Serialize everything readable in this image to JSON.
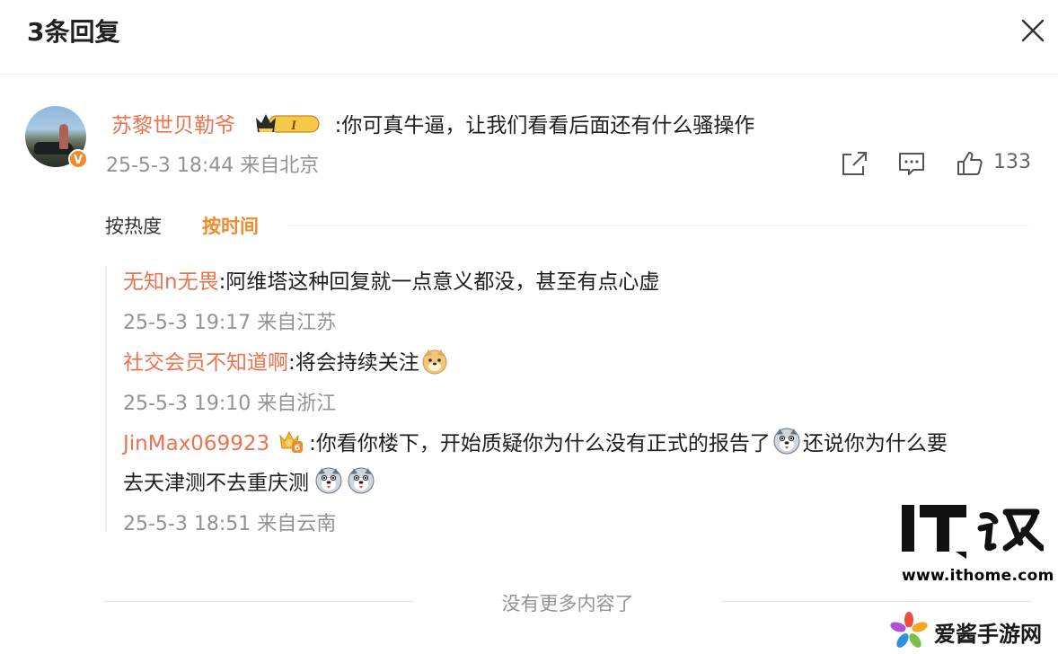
{
  "header": {
    "title": "3条回复",
    "close_icon": "close-icon"
  },
  "main_comment": {
    "username": "苏黎世贝勒爷",
    "badge_icon": "crown-level-1-badge",
    "badge_text": "I",
    "text": ":你可真牛逼，让我们看看后面还有什么骚操作",
    "meta": "25-5-3 18:44 来自北京",
    "verified_icon": "verified-v-icon",
    "verified_text": "V",
    "actions": {
      "share_icon": "share-icon",
      "comment_icon": "comment-icon",
      "like_icon": "thumbs-up-icon",
      "like_count": "133"
    }
  },
  "sort": {
    "hot": "按热度",
    "time": "按时间",
    "active": "time"
  },
  "replies": [
    {
      "username": "无知n无畏",
      "text": ":阿维塔这种回复就一点意义都没，甚至有点心虚",
      "meta": "25-5-3 19:17 来自江苏"
    },
    {
      "username": "社交会员不知道啊",
      "text": ":将会持续关注",
      "emoji": "doge-emoji",
      "meta": "25-5-3 19:10 来自浙江"
    },
    {
      "username": "JinMax069923",
      "badge_icon": "member-level-6-badge",
      "badge_text": "6",
      "text_part1": ":你看你楼下，开始质疑你为什么没有正式的报告了",
      "emoji1": "husky-emoji",
      "text_part2": "还说你为什么要",
      "text_line2": "去天津测不去重庆测",
      "emoji2": "husky-emoji",
      "meta": "25-5-3 18:51 来自云南"
    }
  ],
  "footer": {
    "end_text": "没有更多内容了"
  },
  "watermarks": {
    "ithome_logo_text": "IT之家",
    "ithome_url": "www.ithome.com",
    "aijiang_text": "爱酱手游网"
  },
  "colors": {
    "username": "#eb7350",
    "accent": "#f08a2a",
    "meta": "#939393"
  }
}
